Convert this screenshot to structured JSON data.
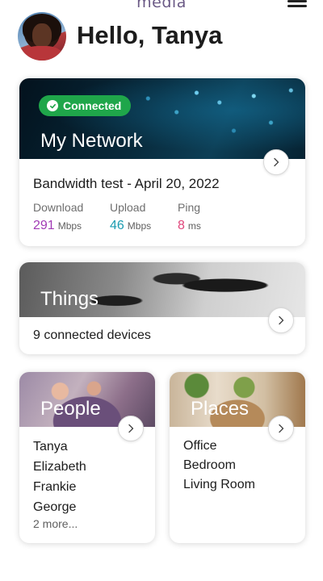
{
  "header": {
    "brand": "media",
    "greeting": "Hello, Tanya"
  },
  "network": {
    "status": "Connected",
    "title": "My Network",
    "test_title": "Bandwidth test - April 20, 2022",
    "download": {
      "label": "Download",
      "value": "291",
      "unit": "Mbps",
      "color": "#a23bb5"
    },
    "upload": {
      "label": "Upload",
      "value": "46",
      "unit": "Mbps",
      "color": "#1a9bb0"
    },
    "ping": {
      "label": "Ping",
      "value": "8",
      "unit": "ms",
      "color": "#e0457a"
    }
  },
  "things": {
    "title": "Things",
    "subtitle": "9 connected devices"
  },
  "people": {
    "title": "People",
    "names": [
      "Tanya",
      "Elizabeth",
      "Frankie",
      "George"
    ],
    "more": "2 more..."
  },
  "places": {
    "title": "Places",
    "rooms": [
      "Office",
      "Bedroom",
      "Living Room"
    ]
  },
  "colors": {
    "connected_badge": "#1fa64a",
    "brand": "#6b5a86"
  },
  "icons": [
    "menu-icon",
    "check-icon",
    "chevron-right-icon"
  ]
}
